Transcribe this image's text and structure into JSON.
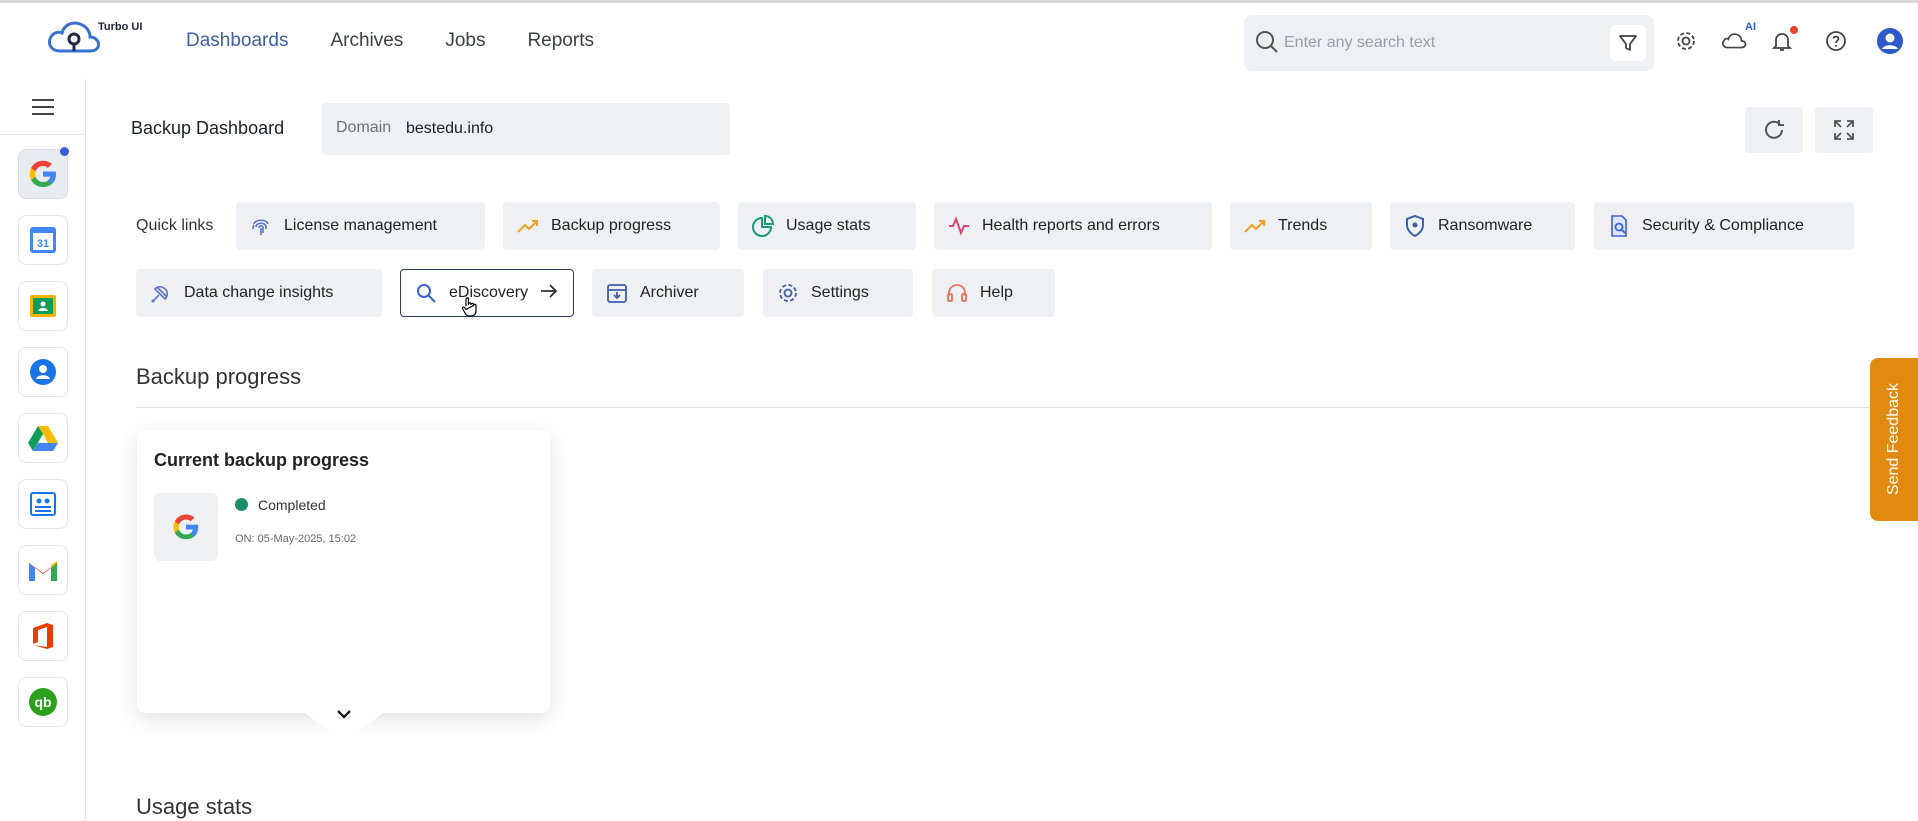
{
  "brand": {
    "name": "Turbo UI"
  },
  "nav": {
    "items": [
      "Dashboards",
      "Archives",
      "Jobs",
      "Reports"
    ],
    "active": "Dashboards"
  },
  "search": {
    "placeholder": "Enter any search text"
  },
  "topbar": {
    "ai_label": "AI",
    "icons": [
      "settings-icon",
      "cloud-ai-icon",
      "bell-icon",
      "help-icon",
      "user-icon"
    ]
  },
  "sidebar": {
    "apps": [
      "google",
      "calendar",
      "classroom",
      "contacts",
      "drive",
      "directory",
      "gmail",
      "office",
      "quickbooks"
    ]
  },
  "header": {
    "title": "Backup Dashboard",
    "domain_label": "Domain",
    "domain_value": "bestedu.info"
  },
  "quick_links": {
    "label": "Quick links",
    "items": [
      "License management",
      "Backup progress",
      "Usage stats",
      "Health reports and errors",
      "Trends",
      "Ransomware",
      "Security & Compliance",
      "Data change insights",
      "eDiscovery",
      "Archiver",
      "Settings",
      "Help"
    ]
  },
  "sections": {
    "backup_progress": "Backup progress",
    "usage_stats": "Usage stats"
  },
  "backup_card": {
    "title": "Current backup progress",
    "status": "Completed",
    "timestamp": "ON: 05-May-2025, 15:02"
  },
  "feedback": {
    "label": "Send Feedback"
  },
  "colors": {
    "accent": "#3d5fa8",
    "success": "#1a8e6a",
    "feedback": "#e28a10"
  }
}
